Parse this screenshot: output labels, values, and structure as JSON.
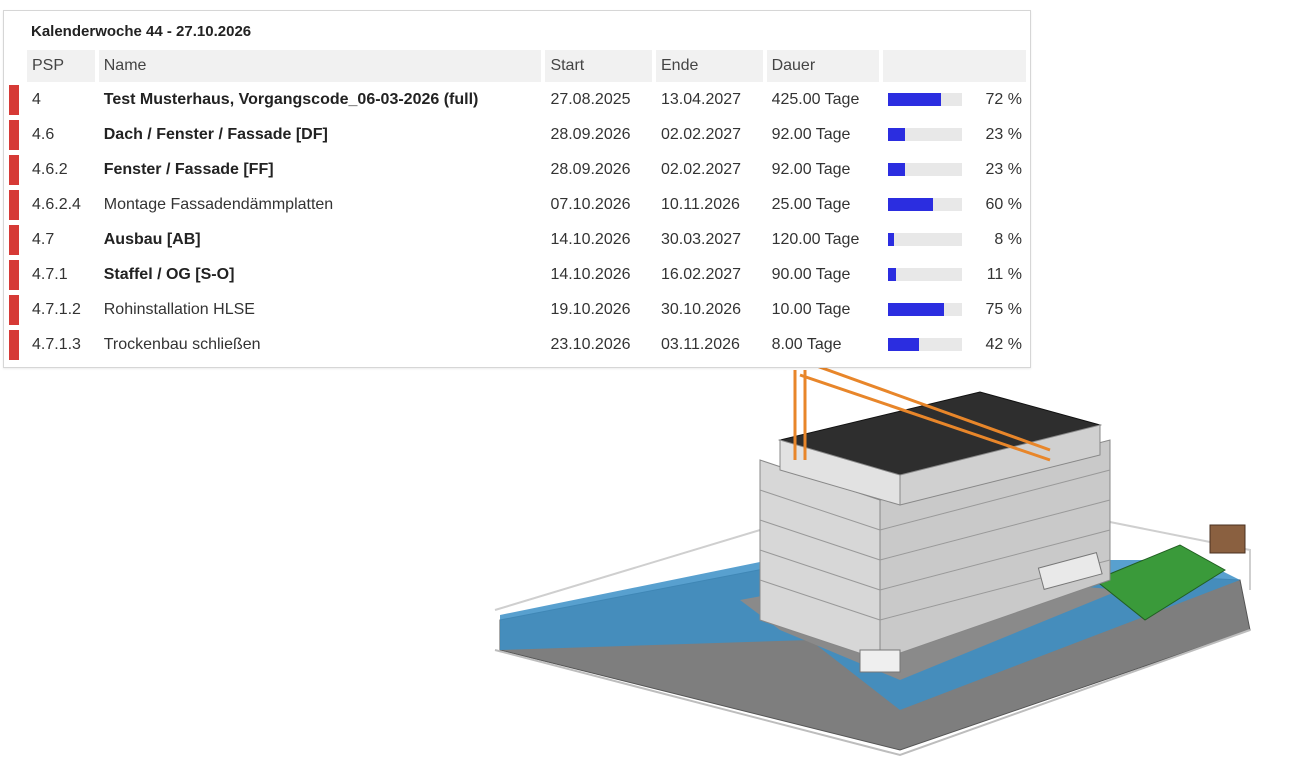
{
  "panel": {
    "title": "Kalenderwoche 44 - 27.10.2026",
    "columns": [
      "PSP",
      "Name",
      "Start",
      "Ende",
      "Dauer"
    ],
    "rows": [
      {
        "psp": "4",
        "name": "Test Musterhaus, Vorgangscode_06-03-2026 (full)",
        "start": "27.08.2025",
        "end": "13.04.2027",
        "duration": "425.00 Tage",
        "progress": 72,
        "pct_label": "72 %",
        "bold": true
      },
      {
        "psp": "4.6",
        "name": "Dach / Fenster / Fassade [DF]",
        "start": "28.09.2026",
        "end": "02.02.2027",
        "duration": "92.00 Tage",
        "progress": 23,
        "pct_label": "23 %",
        "bold": true
      },
      {
        "psp": "4.6.2",
        "name": "Fenster / Fassade [FF]",
        "start": "28.09.2026",
        "end": "02.02.2027",
        "duration": "92.00 Tage",
        "progress": 23,
        "pct_label": "23 %",
        "bold": true
      },
      {
        "psp": "4.6.2.4",
        "name": "Montage Fassadendämmplatten",
        "start": "07.10.2026",
        "end": "10.11.2026",
        "duration": "25.00 Tage",
        "progress": 60,
        "pct_label": "60 %",
        "bold": false
      },
      {
        "psp": "4.7",
        "name": "Ausbau [AB]",
        "start": "14.10.2026",
        "end": "30.03.2027",
        "duration": "120.00 Tage",
        "progress": 8,
        "pct_label": "8 %",
        "bold": true
      },
      {
        "psp": "4.7.1",
        "name": "Staffel / OG [S-O]",
        "start": "14.10.2026",
        "end": "16.02.2027",
        "duration": "90.00 Tage",
        "progress": 11,
        "pct_label": "11 %",
        "bold": true
      },
      {
        "psp": "4.7.1.2",
        "name": "Rohinstallation HLSE",
        "start": "19.10.2026",
        "end": "30.10.2026",
        "duration": "10.00 Tage",
        "progress": 75,
        "pct_label": "75 %",
        "bold": false
      },
      {
        "psp": "4.7.1.3",
        "name": "Trockenbau schließen",
        "start": "23.10.2026",
        "end": "03.11.2026",
        "duration": "8.00 Tage",
        "progress": 42,
        "pct_label": "42 %",
        "bold": false
      }
    ]
  },
  "colors": {
    "marker": "#d63a36",
    "progress_fill": "#2b2de0",
    "progress_track": "#e8e8e8",
    "site_blue": "#3b8fc7",
    "crane_orange": "#e8862a",
    "container_green": "#3a9a3a"
  },
  "scene": {
    "icon": "construction-site-3d-model"
  }
}
